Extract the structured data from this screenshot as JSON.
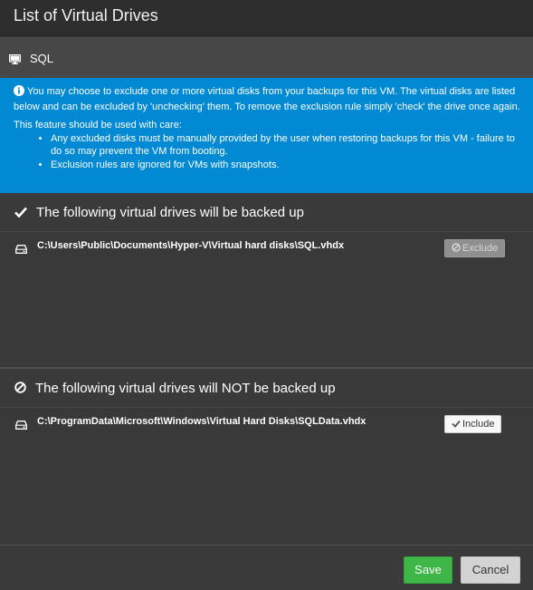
{
  "dialog": {
    "title": "List of Virtual Drives"
  },
  "vm": {
    "name": "SQL",
    "icon": "monitor-icon"
  },
  "info": {
    "icon": "info-circle-icon",
    "paragraph1": "You may choose to exclude one or more virtual disks from your backups for this VM. The virtual disks are listed below and can be excluded by 'unchecking' them. To remove the exclusion rule simply 'check' the drive once again.",
    "paragraph2": "This feature should be used with care:",
    "bullets": [
      "Any excluded disks must be manually provided by the user when restoring backups for this VM - failure to do so may prevent the VM from booting.",
      "Exclusion rules are ignored for VMs with snapshots."
    ]
  },
  "included_section": {
    "icon": "checkmark-icon",
    "title": "The following virtual drives will be backed up",
    "drives": [
      {
        "path": "C:\\Users\\Public\\Documents\\Hyper-V\\Virtual hard disks\\SQL.vhdx",
        "action_label": "Exclude",
        "action_icon": "ban-icon",
        "icon": "hard-drive-icon"
      }
    ]
  },
  "excluded_section": {
    "icon": "ban-icon",
    "title": "The following virtual drives will NOT be backed up",
    "drives": [
      {
        "path": "C:\\ProgramData\\Microsoft\\Windows\\Virtual Hard Disks\\SQLData.vhdx",
        "action_label": "Include",
        "action_icon": "checkmark-icon",
        "icon": "hard-drive-icon"
      }
    ]
  },
  "footer": {
    "save_label": "Save",
    "cancel_label": "Cancel"
  },
  "colors": {
    "info_background": "#0289d4",
    "save_button": "#3fb648",
    "cancel_button": "#d3d3d3",
    "window_background": "#3a3a3a"
  }
}
